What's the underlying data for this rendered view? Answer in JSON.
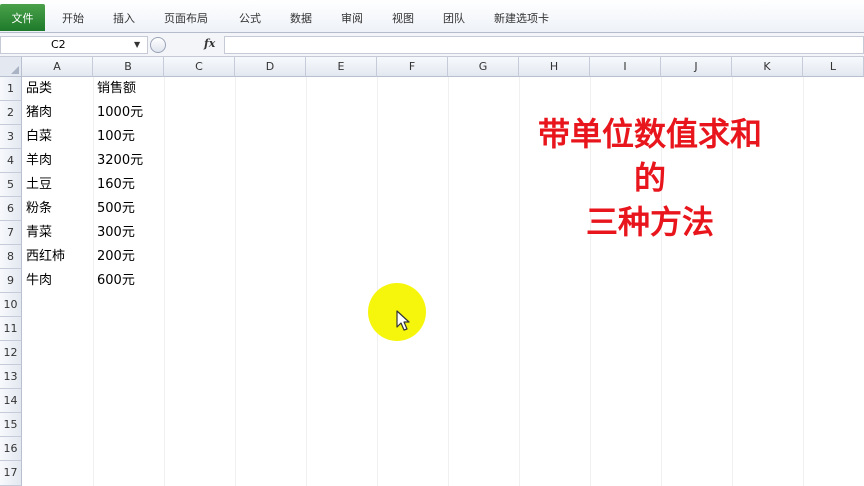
{
  "ribbon": {
    "file_tab": "文件",
    "tabs": [
      "开始",
      "插入",
      "页面布局",
      "公式",
      "数据",
      "审阅",
      "视图",
      "团队",
      "新建选项卡"
    ]
  },
  "formula_bar": {
    "name_box": "C2",
    "fx_label": "fx",
    "formula": ""
  },
  "columns": [
    "A",
    "B",
    "C",
    "D",
    "E",
    "F",
    "G",
    "H",
    "I",
    "J",
    "K",
    "L"
  ],
  "rows": [
    "1",
    "2",
    "3",
    "4",
    "5",
    "6",
    "7",
    "8",
    "9",
    "10",
    "11",
    "12",
    "13",
    "14",
    "15",
    "16",
    "17"
  ],
  "table": {
    "headers": [
      "品类",
      "销售额"
    ],
    "rows": [
      [
        "猪肉",
        "1000元"
      ],
      [
        "白菜",
        "100元"
      ],
      [
        "羊肉",
        "3200元"
      ],
      [
        "土豆",
        "160元"
      ],
      [
        "粉条",
        "500元"
      ],
      [
        "青菜",
        "300元"
      ],
      [
        "西红柿",
        "200元"
      ],
      [
        "牛肉",
        "600元"
      ]
    ]
  },
  "overlay": {
    "lines": [
      "带单位数值求和",
      "的",
      "三种方法"
    ]
  },
  "colors": {
    "overlay_text": "#e8161c",
    "file_tab": "#1e7a2a",
    "cursor_highlight": "#f5f500"
  }
}
